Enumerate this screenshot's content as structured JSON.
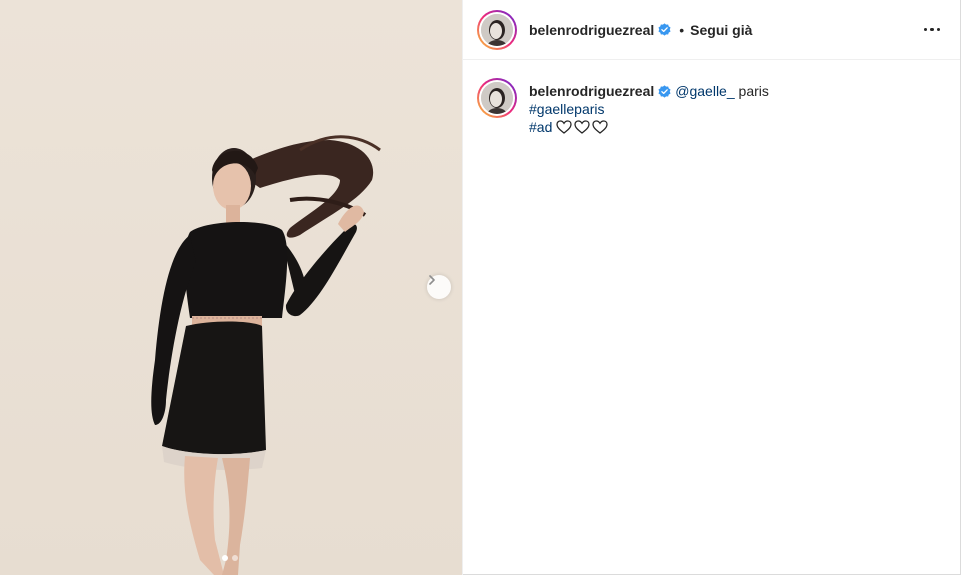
{
  "post": {
    "username": "belenrodriguezreal",
    "separator": "•",
    "follow_status": "Segui già",
    "caption": {
      "username": "belenrodriguezreal",
      "mention": "@gaelle_",
      "after_mention": " paris",
      "hashtag_1": "#gaelleparis",
      "hashtag_2": "#ad",
      "hearts": [
        "white-heart-icon",
        "white-heart-icon",
        "white-heart-icon"
      ]
    },
    "carousel": {
      "current": 1,
      "total": 2
    }
  },
  "colors": {
    "photo_background": "#ece3d8",
    "link": "#00376b",
    "verified": "#3897f0",
    "text": "#262626"
  }
}
